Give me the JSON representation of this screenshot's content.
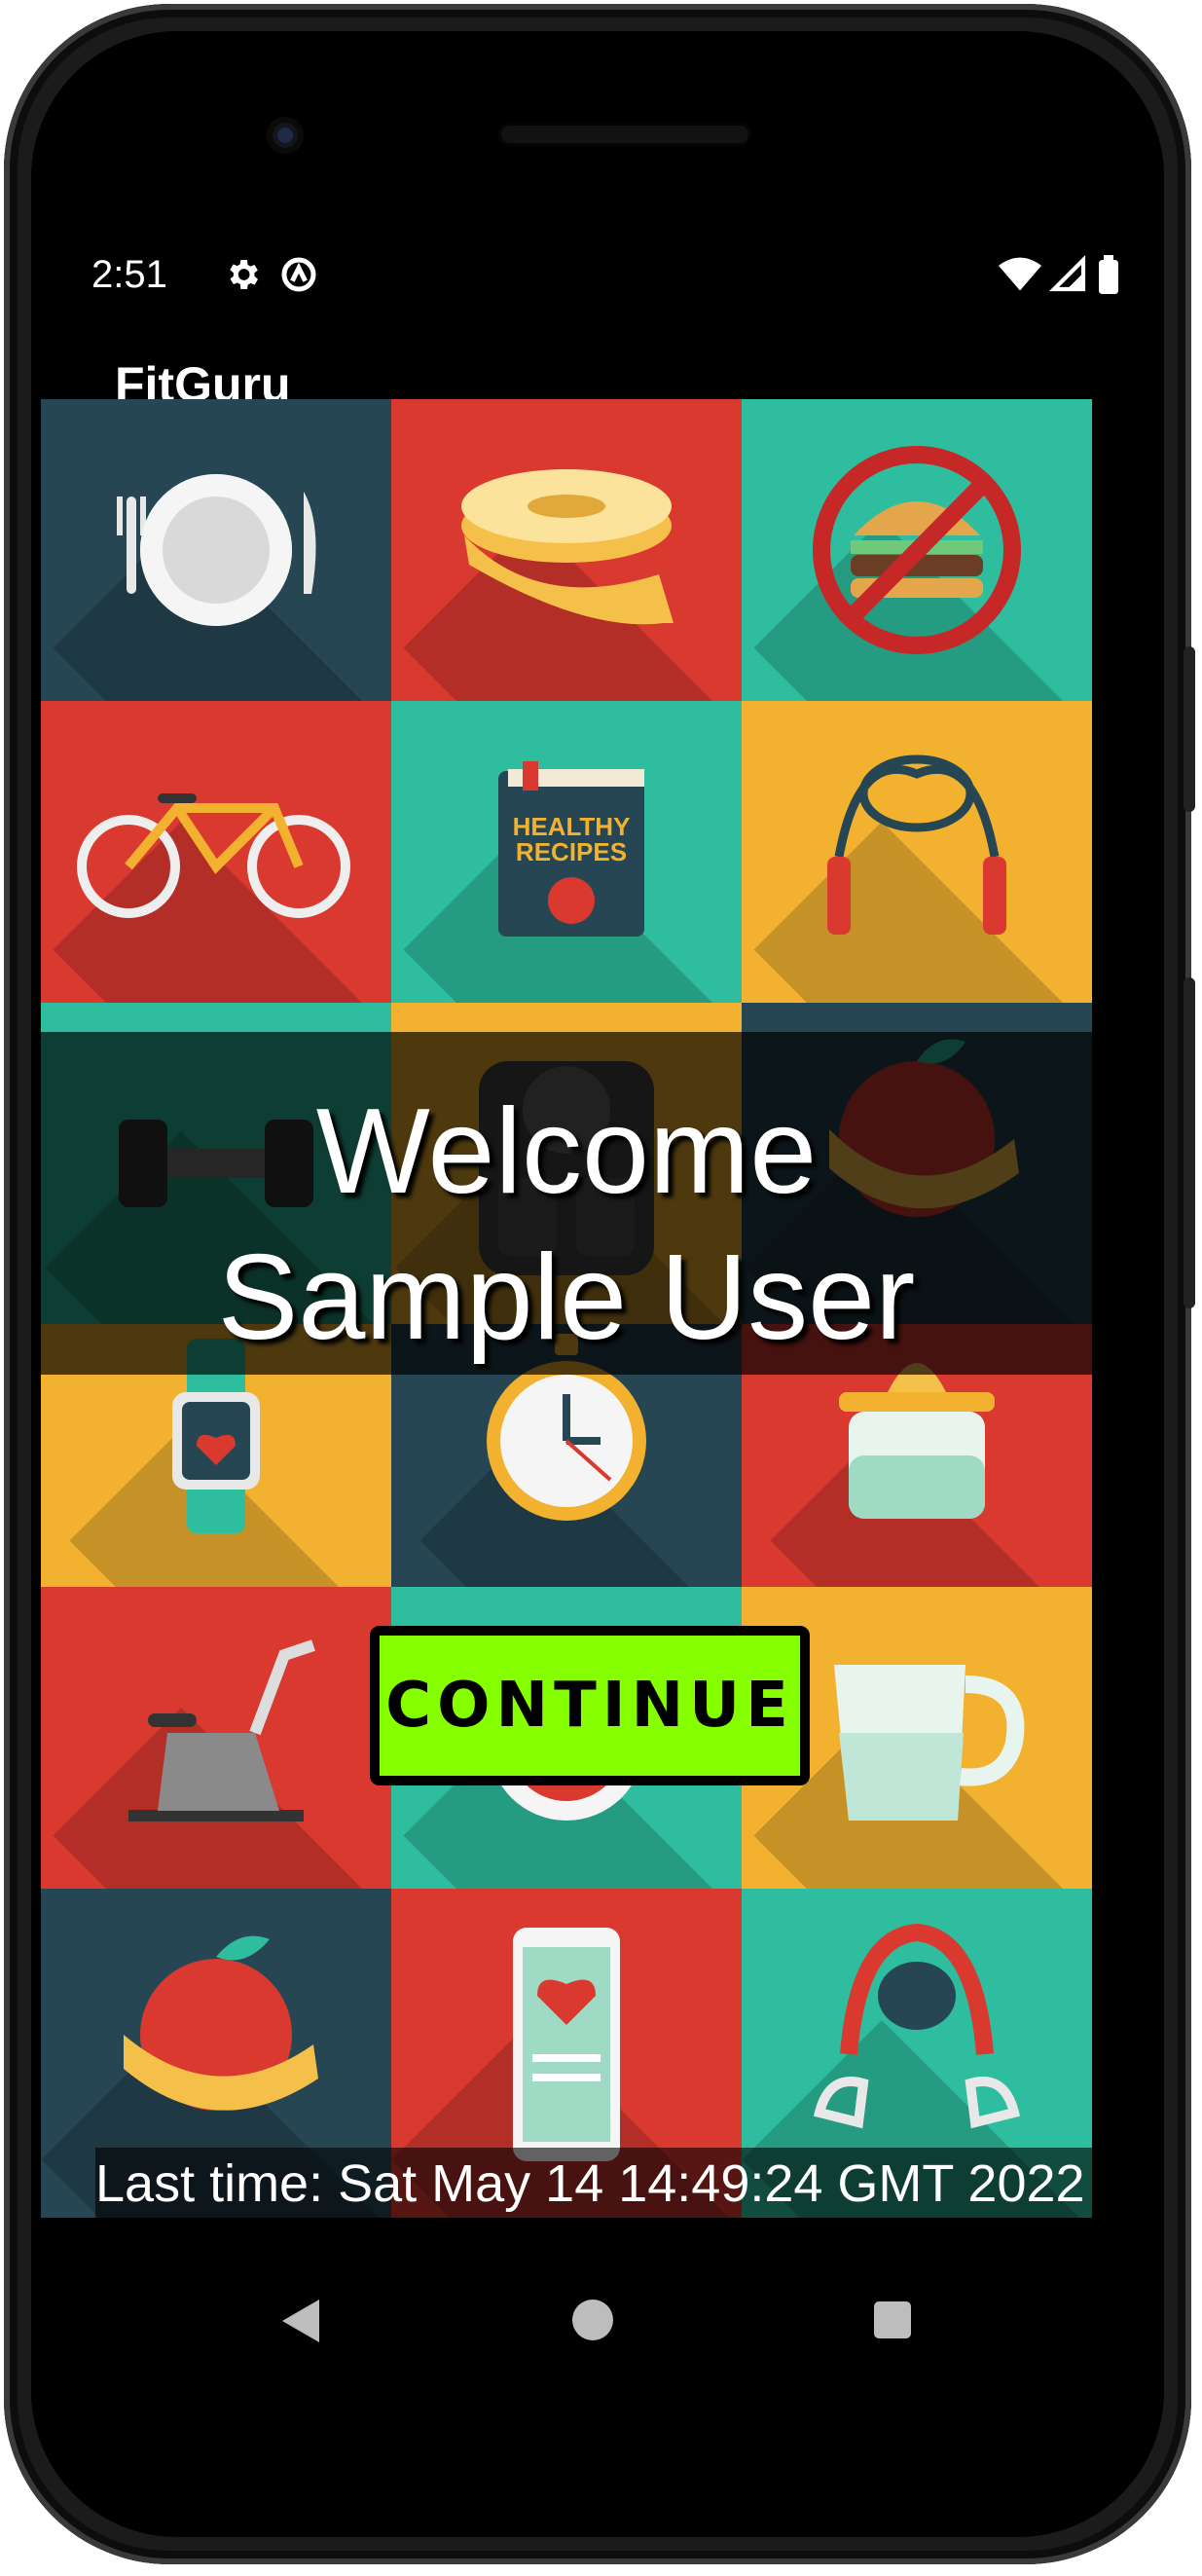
{
  "status_bar": {
    "time": "2:51",
    "icons": [
      "settings-gear-icon",
      "cast-icon",
      "wifi-icon",
      "cell-signal-icon",
      "battery-icon"
    ]
  },
  "app_bar": {
    "title": "FitGuru"
  },
  "background_tiles": [
    {
      "icon": "plate-fork-knife-icon",
      "color": "#264653"
    },
    {
      "icon": "measuring-tape-icon",
      "color": "#d9392f"
    },
    {
      "icon": "no-burger-icon",
      "color": "#2ebd9e"
    },
    {
      "icon": "bicycle-icon",
      "color": "#d9392f"
    },
    {
      "icon": "healthy-recipes-book-icon",
      "color": "#2ebd9e"
    },
    {
      "icon": "jump-rope-icon",
      "color": "#f2b230"
    },
    {
      "icon": "dumbbell-icon",
      "color": "#2ebd9e"
    },
    {
      "icon": "bathroom-scale-icon",
      "color": "#f2b230"
    },
    {
      "icon": "apple-tape-icon",
      "color": "#264653"
    },
    {
      "icon": "smartwatch-heart-icon",
      "color": "#f2b230"
    },
    {
      "icon": "stopwatch-icon",
      "color": "#264653"
    },
    {
      "icon": "juicer-icon",
      "color": "#d9392f"
    },
    {
      "icon": "exercise-bike-icon",
      "color": "#d9392f"
    },
    {
      "icon": "target-icon",
      "color": "#2ebd9e"
    },
    {
      "icon": "measuring-cup-icon",
      "color": "#f2b230"
    },
    {
      "icon": "apple-tape-icon",
      "color": "#264653"
    },
    {
      "icon": "phone-heart-app-icon",
      "color": "#d9392f"
    },
    {
      "icon": "kettlebell-icon",
      "color": "#2ebd9e"
    }
  ],
  "book_label": "HEALTHY RECIPES",
  "welcome": {
    "line1": "Welcome",
    "line2": "Sample User"
  },
  "continue_label": "CONTINUE",
  "last_time": "Last time: Sat May 14 14:49:24 GMT 2022",
  "colors": {
    "continue_button": "#86ff00",
    "tile_dark": "#264653",
    "tile_red": "#d9392f",
    "tile_teal": "#2ebd9e",
    "tile_yellow": "#f2b230"
  },
  "nav_bar": {
    "icons": [
      "back-icon",
      "home-icon",
      "recents-icon"
    ]
  }
}
